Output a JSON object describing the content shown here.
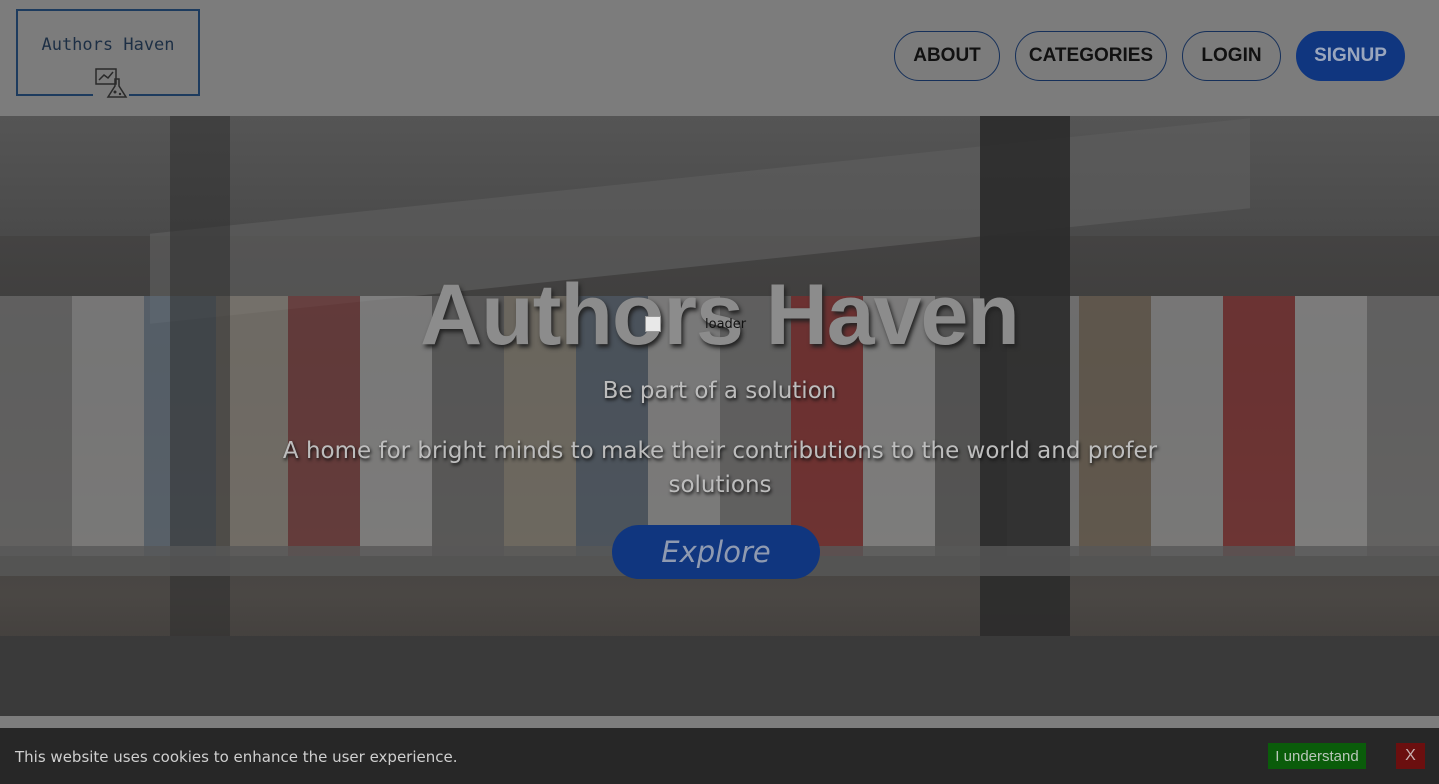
{
  "header": {
    "logo_text": "Authors Haven",
    "logo_icon": "flask-chart-icon",
    "nav": {
      "about": "ABOUT",
      "categories": "CATEGORIES",
      "login": "LOGIN",
      "signup": "SIGNUP"
    }
  },
  "hero": {
    "title": "Authors Haven",
    "loader_alt": "loader",
    "subtitle": "Be part of a solution",
    "description": "A home for bright minds to make their contributions to the world and profer solutions",
    "cta_label": "Explore"
  },
  "cookie_banner": {
    "message": "This website uses cookies to enhance the user experience.",
    "accept_label": "I understand",
    "close_label": "X"
  },
  "colors": {
    "primary": "#10367f",
    "accept": "#0a5c0a",
    "close": "#6b0f0f"
  }
}
